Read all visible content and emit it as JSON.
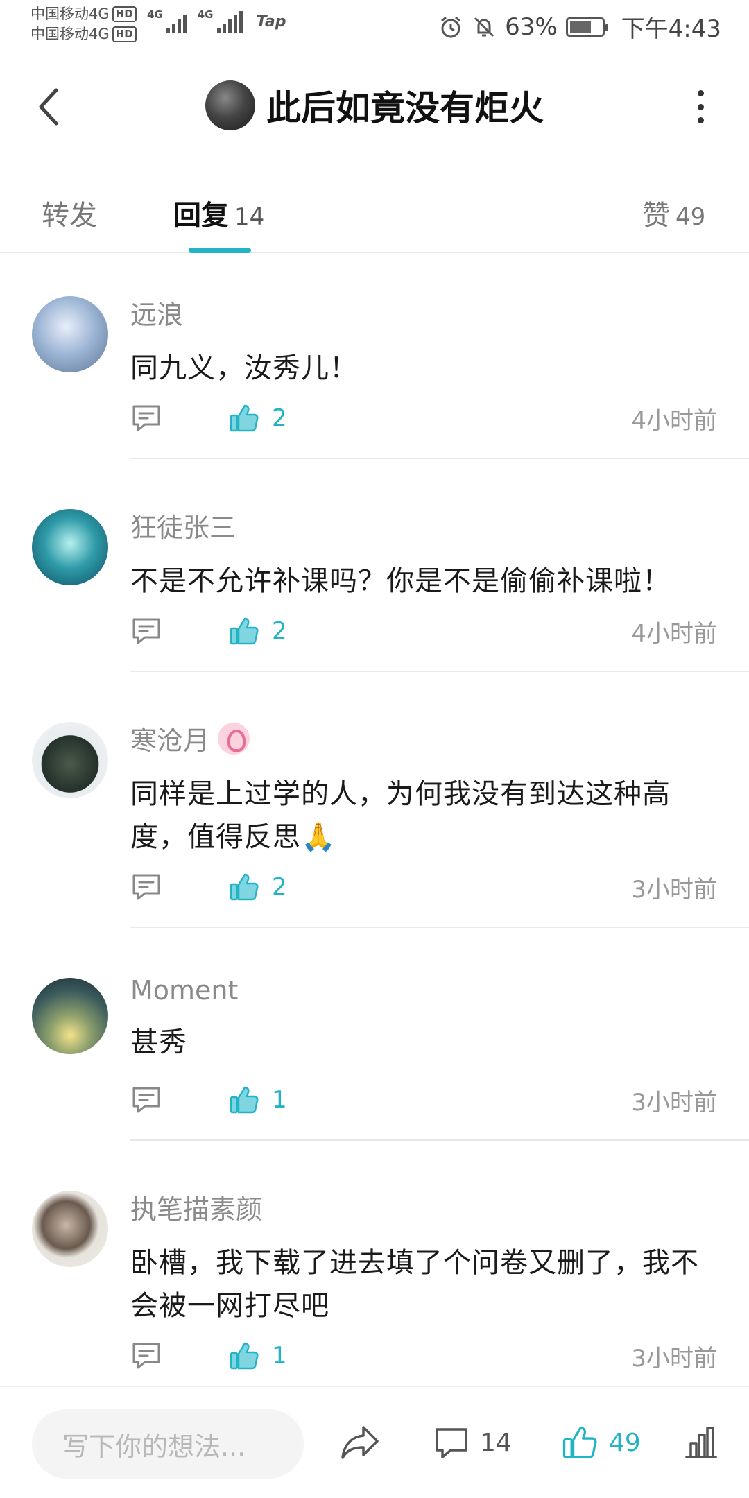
{
  "status_bar": {
    "carrier1": "中国移动4G",
    "carrier2": "中国移动4G",
    "hd_badge": "HD",
    "net1": "4G",
    "net2": "4G",
    "tap_label": "Tap",
    "battery_pct": "63%",
    "time": "下午4:43"
  },
  "header": {
    "title": "此后如竟没有炬火"
  },
  "tabs": {
    "forward": {
      "label": "转发"
    },
    "reply": {
      "label": "回复",
      "count": "14"
    },
    "like": {
      "label": "赞",
      "count": "49"
    }
  },
  "comments": [
    {
      "name": "远浪",
      "text": "同九义，汝秀儿！",
      "likes": "2",
      "time": "4小时前",
      "badge": false
    },
    {
      "name": "狂徒张三",
      "text": "不是不允许补课吗？你是不是偷偷补课啦！",
      "likes": "2",
      "time": "4小时前",
      "badge": false
    },
    {
      "name": "寒沧月",
      "text": "同样是上过学的人，为何我没有到达这种高度，值得反思🙏",
      "likes": "2",
      "time": "3小时前",
      "badge": true
    },
    {
      "name": "Moment",
      "text": "甚秀",
      "likes": "1",
      "time": "3小时前",
      "badge": false
    },
    {
      "name": "执笔描素颜",
      "text": "卧槽，我下载了进去填了个问卷又删了，我不会被一网打尽吧",
      "likes": "1",
      "time": "3小时前",
      "badge": false
    }
  ],
  "bottom_bar": {
    "input_placeholder": "写下你的想法...",
    "comment_count": "14",
    "like_count": "49"
  },
  "colors": {
    "accent": "#22b3c5",
    "muted_text": "#8a8a8a"
  },
  "icons": [
    "back-arrow-icon",
    "more-icon",
    "comment-icon",
    "thumbs-up-icon",
    "share-icon",
    "stats-icon"
  ]
}
